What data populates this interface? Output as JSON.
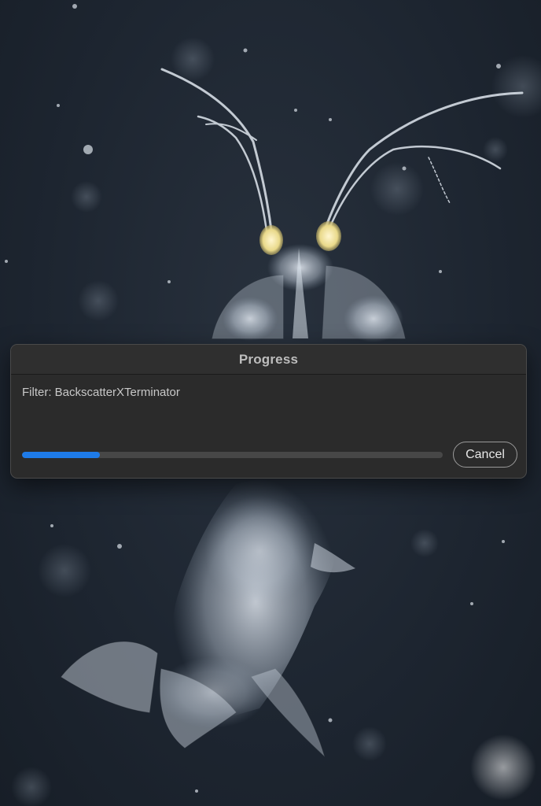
{
  "dialog": {
    "title": "Progress",
    "status_text": "Filter: BackscatterXTerminator",
    "progress_fraction": 0.185,
    "cancel_label": "Cancel"
  },
  "colors": {
    "progress_fill": "#1e7be8",
    "progress_track": "#474747",
    "dialog_bg": "#2b2b2b",
    "background_water": "#1e2631"
  }
}
